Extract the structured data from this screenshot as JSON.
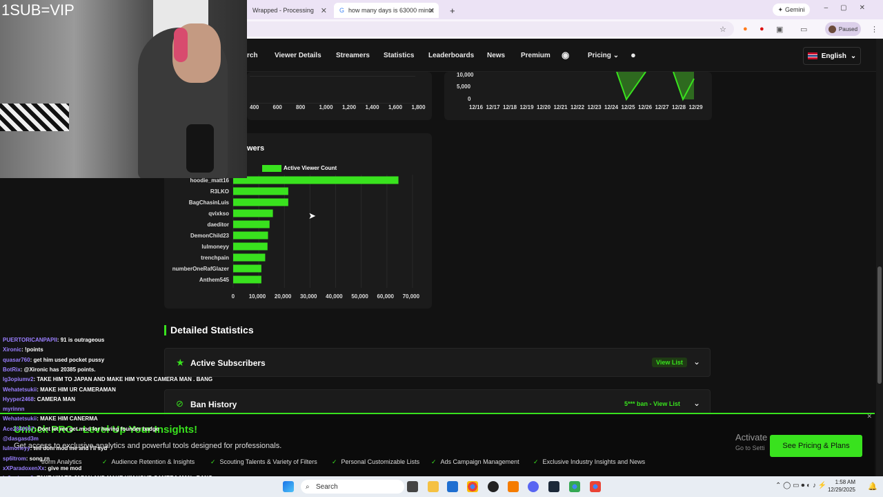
{
  "browser": {
    "tabs": [
      {
        "label": "Wrapped - Processing"
      },
      {
        "label": "how many days is 63000 minut"
      }
    ],
    "gemini_label": "Gemini",
    "profile_status": "Paused"
  },
  "nav": {
    "items": [
      "rch",
      "Viewer Details",
      "Streamers",
      "Statistics",
      "Leaderboards",
      "News",
      "Premium",
      "Pricing"
    ],
    "language": "English"
  },
  "top_left_chart": {
    "x_ticks": [
      "400",
      "600",
      "800",
      "1,000",
      "1,200",
      "1,400",
      "1,600",
      "1,800"
    ]
  },
  "top_right_chart": {
    "y_ticks": [
      "10,000",
      "5,000",
      "0"
    ],
    "x_ticks": [
      "12/16",
      "12/17",
      "12/18",
      "12/19",
      "12/20",
      "12/21",
      "12/22",
      "12/23",
      "12/24",
      "12/25",
      "12/26",
      "12/27",
      "12/28",
      "12/29"
    ]
  },
  "chart_data": {
    "type": "bar",
    "title": "wers",
    "legend": "Active Viewer Count",
    "categories": [
      "hoodie_matt16",
      "R3LKO",
      "BagChasinLuis",
      "qvixkso",
      "daeditor",
      "DemonChild23",
      "lulmoneyy",
      "trenchpain",
      "numberOneRafGlazer",
      "Anthem545"
    ],
    "values": [
      64500,
      21500,
      21500,
      15500,
      14200,
      13600,
      13400,
      12500,
      11000,
      11000
    ],
    "x_ticks": [
      "0",
      "10,000",
      "20,000",
      "30,000",
      "40,000",
      "50,000",
      "60,000",
      "70,000"
    ],
    "xlim": [
      0,
      70000
    ],
    "bar_color": "#39e21e"
  },
  "detailed": {
    "title": "Detailed Statistics",
    "rows": [
      {
        "title": "Active Subscribers",
        "link": "View List"
      },
      {
        "title": "Ban History",
        "link": "5*** ban - View List"
      }
    ]
  },
  "overlay": {
    "vip_text": "1SUB=VIP"
  },
  "chat": [
    {
      "user": "PUERTORICANPAPII",
      "msg": ": 91 is outrageous"
    },
    {
      "user": "Xironic",
      "msg": ": !points"
    },
    {
      "user": "quasar760",
      "msg": ": get him used pocket pussy"
    },
    {
      "user": "BotRix",
      "msg": ": @Xironic has 20385 points."
    },
    {
      "user": "lg3opiumv2",
      "msg": ": TAKE HIM TO JAPAN AND MAKE HIM YOUR CAMERA MAN . BANG"
    },
    {
      "user": "Wehatetsukii",
      "msg": ": MAKE HIM UR CAMERAMAN"
    },
    {
      "user": "Hyyper2468",
      "msg": ": CAMERA MAN"
    },
    {
      "user": "myrinnn",
      "msg": ""
    },
    {
      "user": "Wehatetsukii",
      "msg": ": MAKE HIM CANERMA"
    },
    {
      "user": "Ace2840067",
      "msg": ": Dont let me get mod for having founder badge"
    },
    {
      "user": "@dasgasd3m",
      "msg": ""
    },
    {
      "user": "lulmoneyy",
      "msg": ": tell dom mod me and i'll syd"
    },
    {
      "user": "sp6ltrom",
      "msg": ": song rn"
    },
    {
      "user": "xXParadoxenXx",
      "msg": ": give me mod"
    },
    {
      "user": "lg3opiumv2",
      "msg": ": TAKE HIM TO JAPAN AND MAKE HIM YOUR CAMERA MAN . BANG"
    }
  ],
  "promo": {
    "title": "Unlock PRO - Level Up Your Insights!",
    "subtitle": "Get access to exclusive analytics and powerful tools designed for professionals.",
    "features": [
      "tform Analytics",
      "Audience Retention & Insights",
      "Scouting Talents & Variety of Filters",
      "Personal Customizable Lists",
      "Ads Campaign Management",
      "Exclusive Industry Insights and News"
    ],
    "button": "See Pricing & Plans",
    "activate": "Activate",
    "activate_sub": "Go to Setti"
  },
  "taskbar": {
    "search": "Search",
    "time": "1:58 AM",
    "date": "12/29/2025"
  },
  "colors": {
    "accent": "#39e21e",
    "bg": "#121212",
    "card": "#1b1b1b"
  }
}
